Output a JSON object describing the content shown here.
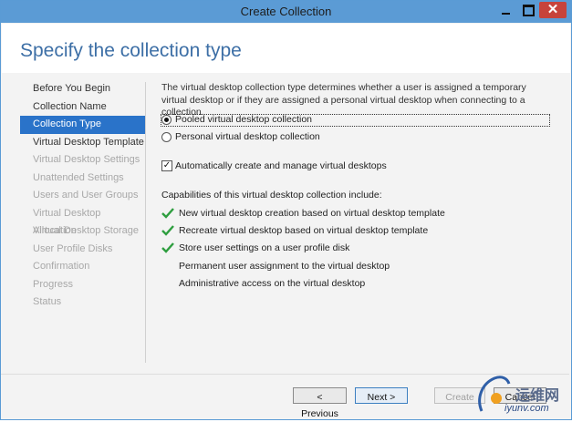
{
  "window": {
    "title": "Create Collection"
  },
  "page": {
    "title": "Specify the collection type"
  },
  "nav": {
    "items": [
      {
        "label": "Before You Begin",
        "state": "enabled"
      },
      {
        "label": "Collection Name",
        "state": "enabled"
      },
      {
        "label": "Collection Type",
        "state": "active"
      },
      {
        "label": "Virtual Desktop Template",
        "state": "enabled"
      },
      {
        "label": "Virtual Desktop Settings",
        "state": "disabled"
      },
      {
        "label": "Unattended Settings",
        "state": "disabled"
      },
      {
        "label": "Users and User Groups",
        "state": "disabled"
      },
      {
        "label": "Virtual Desktop Allocation",
        "state": "disabled"
      },
      {
        "label": "Virtual Desktop Storage",
        "state": "disabled"
      },
      {
        "label": "User Profile Disks",
        "state": "disabled"
      },
      {
        "label": "Confirmation",
        "state": "disabled"
      },
      {
        "label": "Progress",
        "state": "disabled"
      },
      {
        "label": "Status",
        "state": "disabled"
      }
    ]
  },
  "content": {
    "description": "The virtual desktop collection type determines whether a user is assigned a temporary virtual desktop or if they are assigned a personal virtual desktop when connecting to a collection.",
    "options": [
      {
        "label": "Pooled virtual desktop collection",
        "selected": true
      },
      {
        "label": "Personal virtual desktop collection",
        "selected": false
      }
    ],
    "auto_create": {
      "label": "Automatically create and manage virtual desktops",
      "checked": true
    },
    "capabilities_heading": "Capabilities of this virtual desktop collection include:",
    "capabilities": [
      {
        "label": "New virtual desktop creation based on virtual desktop template",
        "supported": true
      },
      {
        "label": "Recreate virtual desktop based on virtual desktop template",
        "supported": true
      },
      {
        "label": "Store user settings on a user profile disk",
        "supported": true
      },
      {
        "label": "Permanent user assignment to the virtual desktop",
        "supported": false
      },
      {
        "label": "Administrative access on the virtual desktop",
        "supported": false
      }
    ]
  },
  "buttons": {
    "previous": "< Previous",
    "next": "Next >",
    "create": "Create",
    "cancel": "Cancel"
  },
  "watermark": {
    "text": "运维网",
    "url": "iyunv.com"
  },
  "colors": {
    "accent": "#2a73c9",
    "title_bar": "#5b9bd5",
    "check": "#2e9e3f",
    "heading": "#3d6fa6"
  }
}
